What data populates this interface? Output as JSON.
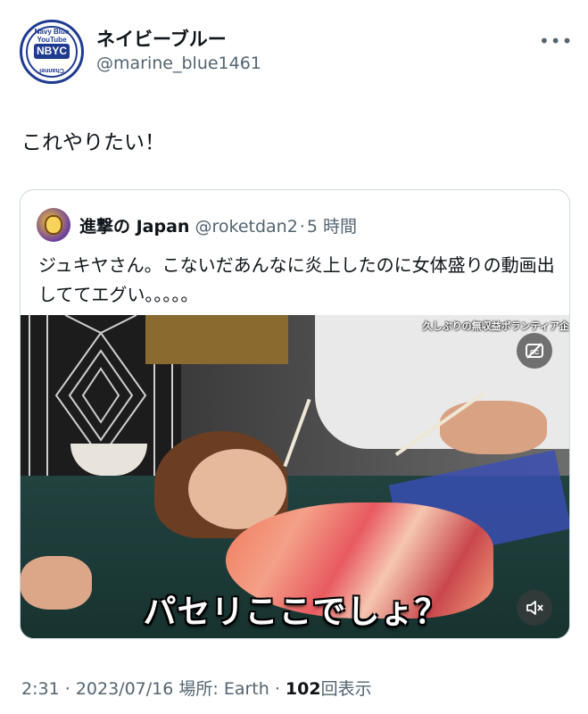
{
  "author": {
    "display_name": "ネイビーブルー",
    "handle": "@marine_blue1461",
    "avatar_badge": "NBYC",
    "avatar_ring_top": "Navy Blue YouTube",
    "avatar_ring_bottom": "Channel"
  },
  "tweet": {
    "text": "これやりたい！"
  },
  "quote": {
    "name": "進撃の Japan",
    "handle": "@roketdan2",
    "separator": "·",
    "time": "5 時間",
    "text": "ジュキヤさん。こないだあんなに炎上したのに女体盛りの動画出しててエグい。。。。。",
    "media": {
      "top_caption": "久しぶりの無収益ボランティア企",
      "caption": "パセリここでしょ？",
      "cc_icon": "captions-off-icon",
      "mute_icon": "volume-muted-icon"
    }
  },
  "footer": {
    "time": "2:31",
    "sep1": "·",
    "date": "2023/07/16",
    "location_label": "場所: Earth",
    "sep2": "·",
    "views_count": "102",
    "views_label": "回表示"
  },
  "colors": {
    "text_primary": "#0f1419",
    "text_secondary": "#536471",
    "border": "#cfd9de",
    "brand": "#1f3b8f"
  }
}
